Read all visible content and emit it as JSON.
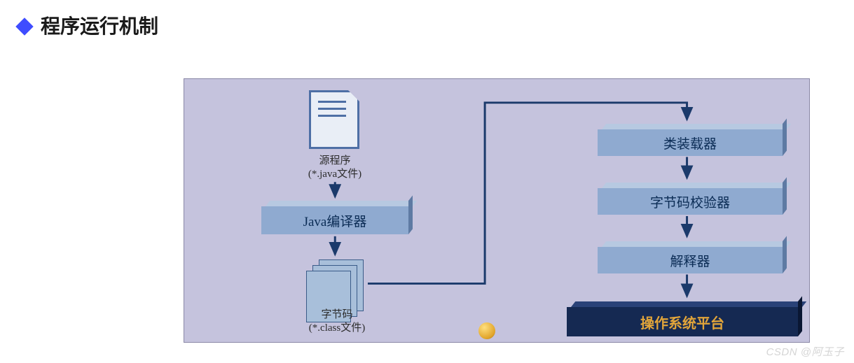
{
  "heading": "程序运行机制",
  "left": {
    "source_label_line1": "源程序",
    "source_label_line2": "(*.java文件)",
    "compiler": "Java编译器",
    "bytecode_label_line1": "字节码",
    "bytecode_label_line2": "(*.class文件)"
  },
  "right": {
    "loader": "类装载器",
    "verifier": "字节码校验器",
    "interpreter": "解释器",
    "platform": "操作系统平台"
  },
  "watermark": "CSDN @阿玉子",
  "chart_data": {
    "type": "flow",
    "nodes": [
      {
        "id": "source",
        "label": "源程序 (*.java文件)",
        "kind": "document"
      },
      {
        "id": "compiler",
        "label": "Java编译器",
        "kind": "process"
      },
      {
        "id": "bytecode",
        "label": "字节码 (*.class文件)",
        "kind": "document-stack"
      },
      {
        "id": "loader",
        "label": "类装载器",
        "kind": "process"
      },
      {
        "id": "verifier",
        "label": "字节码校验器",
        "kind": "process"
      },
      {
        "id": "interpreter",
        "label": "解释器",
        "kind": "process"
      },
      {
        "id": "platform",
        "label": "操作系统平台",
        "kind": "platform"
      }
    ],
    "edges": [
      [
        "source",
        "compiler"
      ],
      [
        "compiler",
        "bytecode"
      ],
      [
        "bytecode",
        "loader"
      ],
      [
        "loader",
        "verifier"
      ],
      [
        "verifier",
        "interpreter"
      ],
      [
        "interpreter",
        "platform"
      ]
    ]
  }
}
